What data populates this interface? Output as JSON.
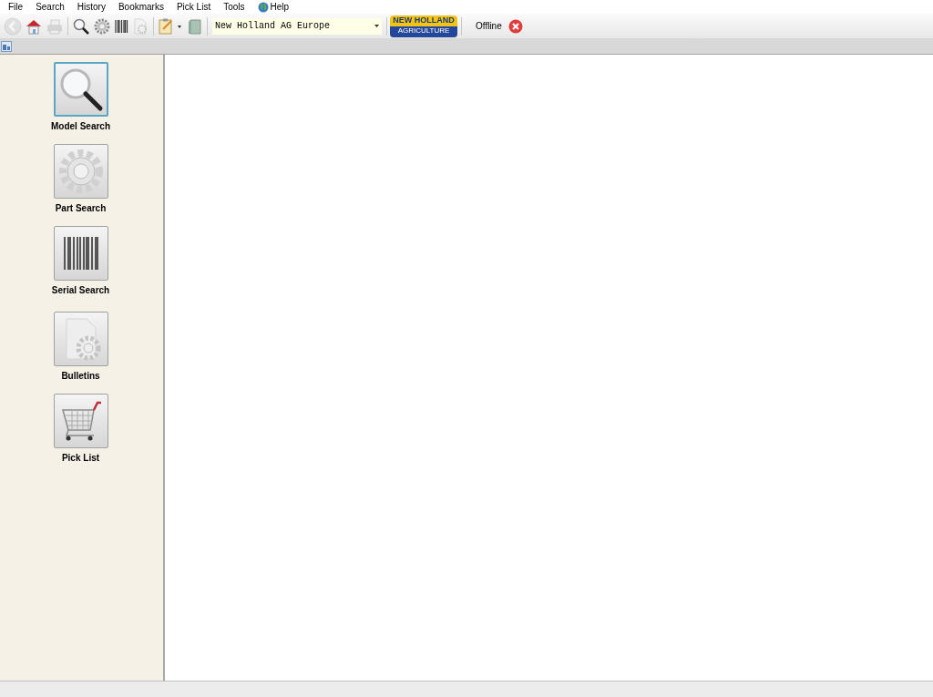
{
  "menu": [
    {
      "label": "File"
    },
    {
      "label": "Search"
    },
    {
      "label": "History"
    },
    {
      "label": "Bookmarks"
    },
    {
      "label": "Pick List"
    },
    {
      "label": "Tools"
    },
    {
      "label": "Help",
      "kind": "globe"
    }
  ],
  "toolbar": [
    {
      "kind": "back",
      "disabled": true
    },
    {
      "kind": "home",
      "disabled": false
    },
    {
      "kind": "print",
      "disabled": true
    },
    {
      "kind": "sep"
    },
    {
      "kind": "search",
      "disabled": false
    },
    {
      "kind": "gear",
      "disabled": false
    },
    {
      "kind": "barcode",
      "disabled": false
    },
    {
      "kind": "docgear",
      "disabled": true
    },
    {
      "kind": "sep"
    },
    {
      "kind": "notepad",
      "disabled": false
    },
    {
      "kind": "book",
      "disabled": false
    }
  ],
  "catalog": {
    "value": "New Holland AG Europe"
  },
  "logo": {
    "line1": "NEW HOLLAND",
    "line2": "AGRICULTURE"
  },
  "status": {
    "label": "Offline",
    "online": false
  },
  "sidebar": [
    {
      "label": "Model Search",
      "kind": "search",
      "selected": true
    },
    {
      "label": "Part Search",
      "kind": "gear",
      "selected": false
    },
    {
      "label": "Serial Search",
      "kind": "barcode",
      "selected": false
    },
    {
      "label": "Bulletins",
      "kind": "docgear",
      "selected": false
    },
    {
      "label": "Pick List",
      "kind": "cart",
      "selected": false
    }
  ]
}
